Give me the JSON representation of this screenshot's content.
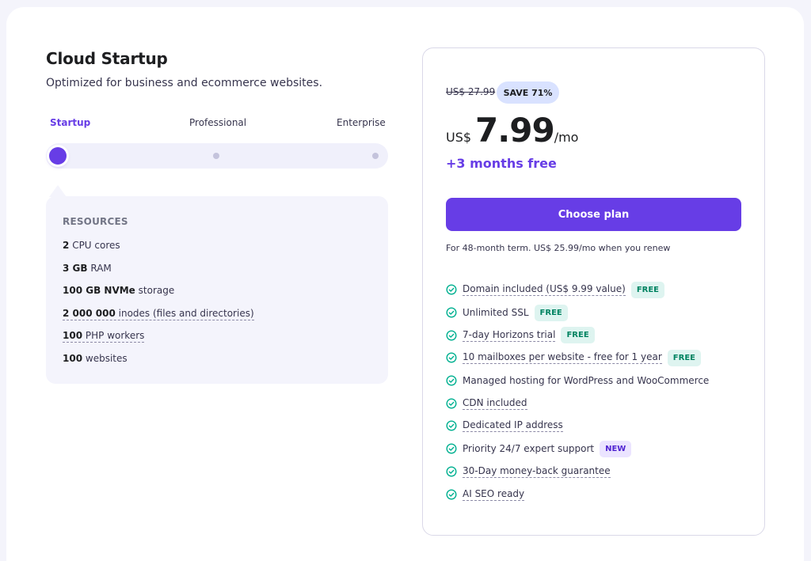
{
  "plan": {
    "title": "Cloud Startup",
    "subtitle": "Optimized for business and ecommerce websites."
  },
  "tiers": {
    "startup": "Startup",
    "professional": "Professional",
    "enterprise": "Enterprise",
    "selected": "Startup"
  },
  "resources": {
    "heading": "RESOURCES",
    "cpu": {
      "value": "2",
      "label": "CPU cores"
    },
    "ram": {
      "value": "3 GB",
      "label": "RAM"
    },
    "storage": {
      "value": "100 GB NVMe",
      "label": "storage"
    },
    "inodes": {
      "value": "2 000 000",
      "label": "inodes (files and directories)"
    },
    "php": {
      "value": "100",
      "label": "PHP workers"
    },
    "websites": {
      "value": "100",
      "label": "websites"
    }
  },
  "pricing": {
    "old_price": "US$ 27.99",
    "save_badge": "SAVE 71%",
    "currency": "US$",
    "price": "7.99",
    "period": "/mo",
    "bonus": "+3 months free",
    "cta": "Choose plan",
    "term": "For 48-month term. US$ 25.99/mo when you renew"
  },
  "features": [
    {
      "text": "Domain included (US$ 9.99 value)",
      "tag": "FREE"
    },
    {
      "text": "Unlimited SSL",
      "tag": "FREE"
    },
    {
      "text": "7-day Horizons trial",
      "tag": "FREE"
    },
    {
      "text": "10 mailboxes per website - free for 1 year",
      "tag": "FREE"
    },
    {
      "text": "Managed hosting for WordPress and WooCommerce"
    },
    {
      "text": "CDN included"
    },
    {
      "text": "Dedicated IP address"
    },
    {
      "text": "Priority 24/7 expert support",
      "tag": "NEW"
    },
    {
      "text": "30-Day money-back guarantee"
    },
    {
      "text": "AI SEO ready"
    }
  ],
  "colors": {
    "accent": "#673de6",
    "free_tag_bg": "#def4f0",
    "free_tag_text": "#008361",
    "new_tag_bg": "#ebe4ff",
    "check": "#00b090"
  }
}
